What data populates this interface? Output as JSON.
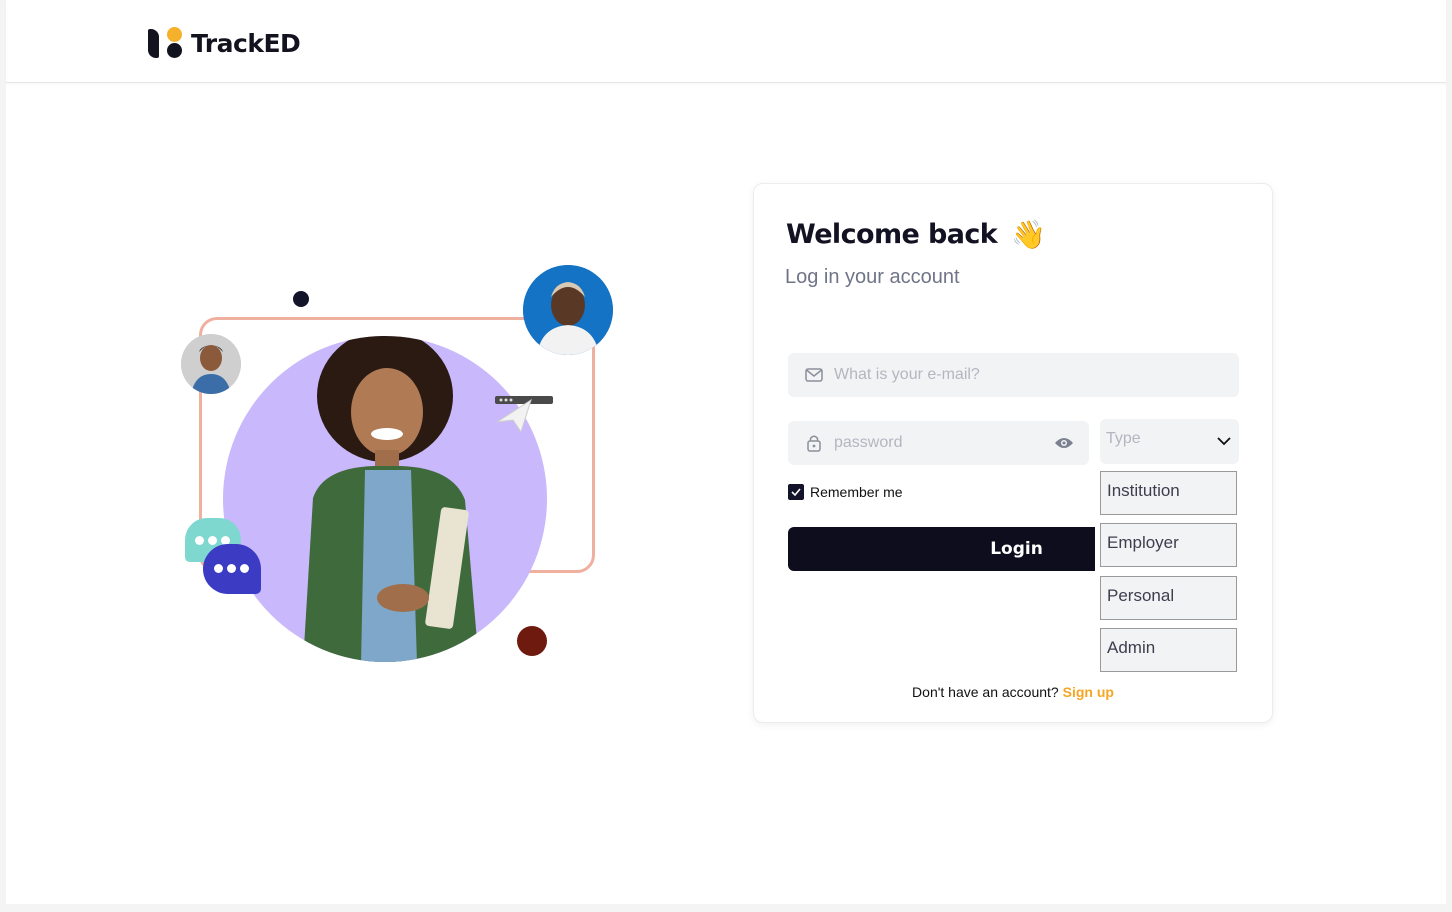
{
  "brand": {
    "name": "TrackED",
    "accent": "#f5b12b",
    "dark": "#13131f"
  },
  "login": {
    "title": "Welcome back",
    "wave_emoji": "👋",
    "subtitle": "Log in your account",
    "email_placeholder": "What is your e-mail?",
    "password_placeholder": "password",
    "type_placeholder": "Type",
    "type_options": [
      "Institution",
      "Employer",
      "Personal",
      "Admin"
    ],
    "remember_label": "Remember me",
    "remember_checked": true,
    "login_label": "Login",
    "signup_prompt": "Don't have an account?",
    "signup_link": "Sign up",
    "signup_color": "#f5a623"
  },
  "icons": {
    "email": "mail-icon",
    "password": "lock-icon",
    "visibility": "eye-icon",
    "select": "chevron-down-icon",
    "remember": "check-icon"
  }
}
